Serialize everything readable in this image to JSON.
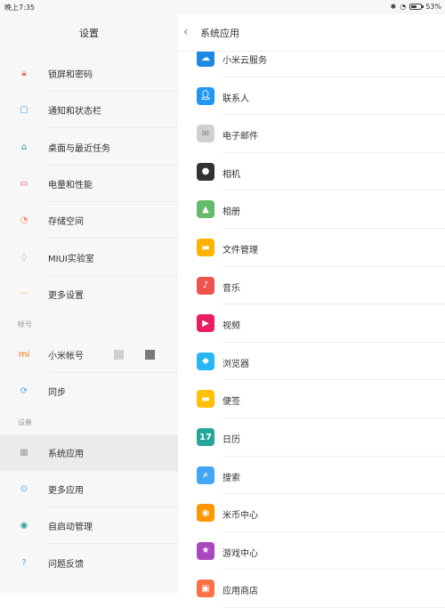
{
  "status_bar": {
    "time": "晚上7:35",
    "battery": "53%",
    "battery_level": 0.53
  },
  "left_panel": {
    "title": "设置",
    "items_top": [
      {
        "label": "锁屏和密码",
        "icon": "lock-icon",
        "color": "#e57373"
      },
      {
        "label": "通知和状态栏",
        "icon": "notification-icon",
        "color": "#42a5f5"
      },
      {
        "label": "桌面与最近任务",
        "icon": "home-icon",
        "color": "#26a69a"
      },
      {
        "label": "电量和性能",
        "icon": "battery-icon",
        "color": "#ef5350"
      },
      {
        "label": "存储空间",
        "icon": "storage-icon",
        "color": "#ff8a65"
      },
      {
        "label": "MIUI实验室",
        "icon": "lab-icon",
        "color": "#bdbdbd"
      },
      {
        "label": "更多设置",
        "icon": "more-icon",
        "color": "#ffa726"
      }
    ],
    "section_account": "帐号",
    "items_account": [
      {
        "label": "小米帐号",
        "icon": "mi-icon",
        "color": "#ff6f00"
      },
      {
        "label": "同步",
        "icon": "sync-icon",
        "color": "#42a5f5"
      }
    ],
    "section_apps": "设备",
    "items_apps": [
      {
        "label": "系统应用",
        "icon": "apps-grid-icon",
        "color": "#9e9e9e"
      },
      {
        "label": "更多应用",
        "icon": "more-apps-icon",
        "color": "#42a5f5"
      },
      {
        "label": "自启动管理",
        "icon": "autostart-icon",
        "color": "#26a69a"
      },
      {
        "label": "问题反馈",
        "icon": "feedback-icon",
        "color": "#42a5f5"
      }
    ]
  },
  "right_panel": {
    "back": "‹",
    "title": "系统应用",
    "apps": [
      {
        "label": "小米云服务",
        "icon": "cloud-icon",
        "color": "#1e88e5"
      },
      {
        "label": "联系人",
        "icon": "contacts-icon",
        "color": "#2196f3"
      },
      {
        "label": "电子邮件",
        "icon": "mail-icon",
        "color": "#d0d0d0"
      },
      {
        "label": "相机",
        "icon": "camera-icon",
        "color": "#333333"
      },
      {
        "label": "相册",
        "icon": "gallery-icon",
        "color": "#66bb6a"
      },
      {
        "label": "文件管理",
        "icon": "folder-icon",
        "color": "#ffb300"
      },
      {
        "label": "音乐",
        "icon": "music-icon",
        "color": "#ef5350"
      },
      {
        "label": "视频",
        "icon": "video-icon",
        "color": "#e91e63"
      },
      {
        "label": "浏览器",
        "icon": "browser-icon",
        "color": "#29b6f6"
      },
      {
        "label": "便签",
        "icon": "notes-icon",
        "color": "#ffc107"
      },
      {
        "label": "日历",
        "icon": "calendar-icon",
        "color": "#26a69a",
        "glyph": "17"
      },
      {
        "label": "搜索",
        "icon": "search-icon",
        "color": "#42a5f5"
      },
      {
        "label": "米币中心",
        "icon": "mibi-icon",
        "color": "#ff9800"
      },
      {
        "label": "游戏中心",
        "icon": "game-icon",
        "color": "#ab47bc"
      },
      {
        "label": "应用商店",
        "icon": "store-icon",
        "color": "#ff7043"
      }
    ]
  }
}
